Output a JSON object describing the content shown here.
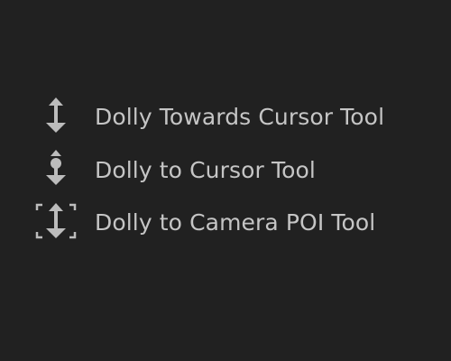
{
  "colors": {
    "background": "#212121",
    "text": "#c5c5c5",
    "icon": "#bcbcbc"
  },
  "menu": {
    "items": [
      {
        "label": "Dolly Towards Cursor Tool",
        "icon": "dolly-towards-cursor-icon"
      },
      {
        "label": "Dolly to Cursor Tool",
        "icon": "dolly-to-cursor-icon"
      },
      {
        "label": "Dolly to Camera POI Tool",
        "icon": "dolly-to-camera-poi-icon"
      }
    ]
  }
}
